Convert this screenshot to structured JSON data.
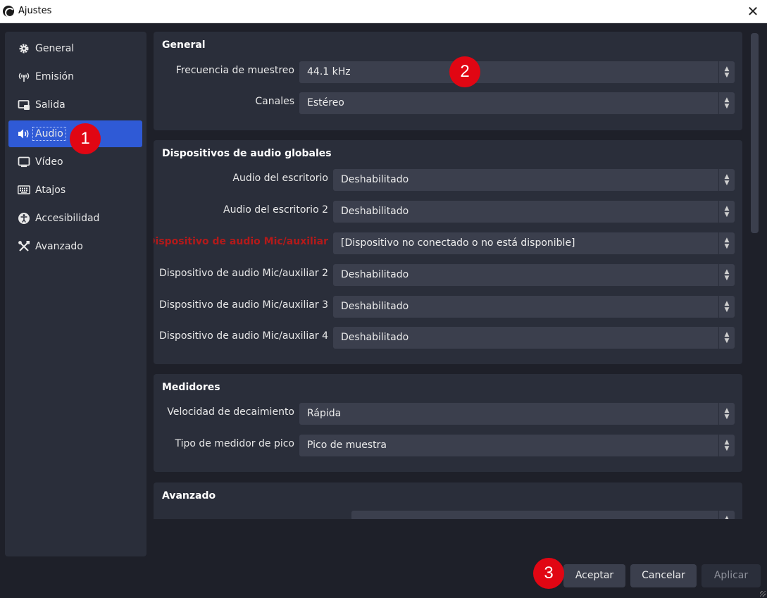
{
  "window": {
    "title": "Ajustes",
    "close_glyph": "✕"
  },
  "sidebar": {
    "items": [
      {
        "label": "General",
        "icon": "gear-icon"
      },
      {
        "label": "Emisión",
        "icon": "broadcast-icon"
      },
      {
        "label": "Salida",
        "icon": "output-icon"
      },
      {
        "label": "Audio",
        "icon": "speaker-icon",
        "active": true
      },
      {
        "label": "Vídeo",
        "icon": "monitor-icon"
      },
      {
        "label": "Atajos",
        "icon": "keyboard-icon"
      },
      {
        "label": "Accesibilidad",
        "icon": "accessibility-icon"
      },
      {
        "label": "Avanzado",
        "icon": "tools-icon"
      }
    ]
  },
  "general": {
    "title": "General",
    "sample_rate": {
      "label": "Frecuencia de muestreo",
      "value": "44.1 kHz"
    },
    "channels": {
      "label": "Canales",
      "value": "Estéreo"
    }
  },
  "global_devices": {
    "title": "Dispositivos de audio globales",
    "rows": [
      {
        "label": "Audio del escritorio",
        "value": "Deshabilitado"
      },
      {
        "label": "Audio del escritorio 2",
        "value": "Deshabilitado"
      },
      {
        "label": "Dispositivo de audio Mic/auxiliar",
        "value": "[Dispositivo no conectado o no está disponible]",
        "error": true
      },
      {
        "label": "Dispositivo de audio Mic/auxiliar 2",
        "value": "Deshabilitado"
      },
      {
        "label": "Dispositivo de audio Mic/auxiliar 3",
        "value": "Deshabilitado"
      },
      {
        "label": "Dispositivo de audio Mic/auxiliar 4",
        "value": "Deshabilitado"
      }
    ]
  },
  "meters": {
    "title": "Medidores",
    "decay": {
      "label": "Velocidad de decaimiento",
      "value": "Rápida"
    },
    "peak": {
      "label": "Tipo de medidor de pico",
      "value": "Pico de muestra"
    }
  },
  "advanced": {
    "title": "Avanzado"
  },
  "buttons": {
    "accept": "Aceptar",
    "cancel": "Cancelar",
    "apply": "Aplicar"
  },
  "annotations": {
    "badge1": "1",
    "badge2": "2",
    "badge3": "3"
  },
  "colors": {
    "accent": "#2f5ad6",
    "error": "#b31a1a",
    "badge": "#e10613"
  }
}
